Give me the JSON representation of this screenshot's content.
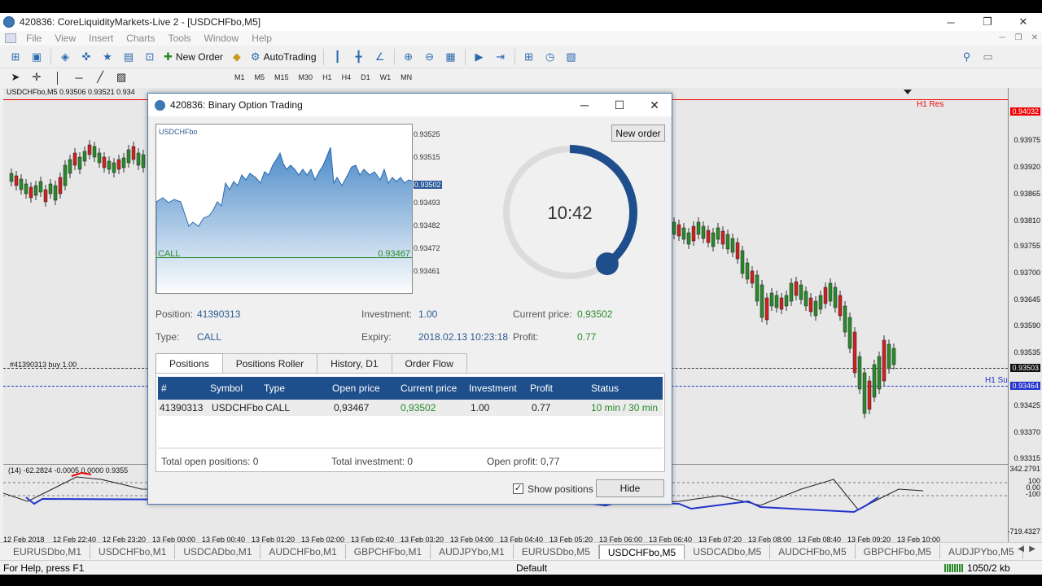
{
  "window": {
    "title": "420836: CoreLiquidityMarkets-Live 2 - [USDCHFbo,M5]"
  },
  "menu": [
    "File",
    "Insert",
    "Charts",
    "Tools",
    "Window",
    "Help"
  ],
  "view_menu": "View",
  "toolbar": {
    "new_order": "New Order",
    "autotrading": "AutoTrading"
  },
  "timeframes": [
    "M1",
    "M5",
    "M15",
    "M30",
    "H1",
    "H4",
    "D1",
    "W1",
    "MN"
  ],
  "chart": {
    "header": "USDCHFbo,M5  0.93506 0.93521 0.934",
    "resistance_label": "H1 Res",
    "support_label": "H1 Su",
    "buy_label": "#41390313 buy 1.00",
    "indicator_label": "(14) -62.2824 -0.0005 0.0000 0.9355",
    "price_scale": [
      "0.94032",
      "0.93975",
      "0.93920",
      "0.93865",
      "0.93810",
      "0.93755",
      "0.93700",
      "0.93645",
      "0.93590",
      "0.93535",
      "0.93503",
      "0.93464",
      "0.93425",
      "0.93370",
      "0.93315"
    ],
    "indicator_scale": [
      "342.2791",
      "100",
      "0.00",
      "-100",
      "-719.4327"
    ],
    "time_axis": [
      "12 Feb 2018",
      "12 Feb 22:40",
      "12 Feb 23:20",
      "13 Feb 00:00",
      "13 Feb 00:40",
      "13 Feb 01:20",
      "13 Feb 02:00",
      "13 Feb 02:40",
      "13 Feb 03:20",
      "13 Feb 04:00",
      "13 Feb 04:40",
      "13 Feb 05:20",
      "13 Feb 06:00",
      "13 Feb 06:40",
      "13 Feb 07:20",
      "13 Feb 08:00",
      "13 Feb 08:40",
      "13 Feb 09:20",
      "13 Feb 10:00"
    ]
  },
  "chart_tabs": [
    "EURUSDbo,M1",
    "USDCHFbo,M1",
    "USDCADbo,M1",
    "AUDCHFbo,M1",
    "GBPCHFbo,M1",
    "AUDJPYbo,M1",
    "EURUSDbo,M5",
    "USDCHFbo,M5",
    "USDCADbo,M5",
    "AUDCHFbo,M5",
    "GBPCHFbo,M5",
    "AUDJPYbo,M5"
  ],
  "active_chart_tab": 7,
  "status": {
    "help": "For Help, press F1",
    "profile": "Default",
    "traffic": "1050/2 kb"
  },
  "dialog": {
    "title": "420836: Binary Option Trading",
    "symbol": "USDCHFbo",
    "call_label": "CALL",
    "call_price": "0.93467",
    "mini_scale": [
      "0.93525",
      "0.93515",
      "0.93502",
      "0.93493",
      "0.93482",
      "0.93472",
      "0.93461"
    ],
    "new_order": "New order",
    "timer": "10:42",
    "timer_progress": 0.4,
    "position_label": "Position:",
    "position": "41390313",
    "type_label": "Type:",
    "type": "CALL",
    "investment_label": "Investment:",
    "investment": "1.00",
    "expiry_label": "Expiry:",
    "expiry": "2018.02.13 10:23:18",
    "current_price_label": "Current price:",
    "current_price": "0,93502",
    "profit_label": "Profit:",
    "profit": "0.77",
    "tabs": [
      "Positions",
      "Positions Roller",
      "History, D1",
      "Order Flow"
    ],
    "table": {
      "headers": [
        "#",
        "Symbol",
        "Type",
        "Open price",
        "Current price",
        "Investment",
        "Profit",
        "Status"
      ],
      "row": [
        "41390313",
        "USDCHFbo",
        "CALL",
        "0,93467",
        "0,93502",
        "1.00",
        "0.77",
        "10 min / 30 min"
      ]
    },
    "totals": {
      "open_positions": "Total open positions:  0",
      "investment": "Total investment:  0",
      "open_profit": "Open profit:  0,77"
    },
    "show_positions": "Show positions",
    "hide": "Hide"
  },
  "colors": {
    "accent": "#1e4f8c",
    "profit_green": "#2a8a2a",
    "resistance_red": "#e00000"
  }
}
